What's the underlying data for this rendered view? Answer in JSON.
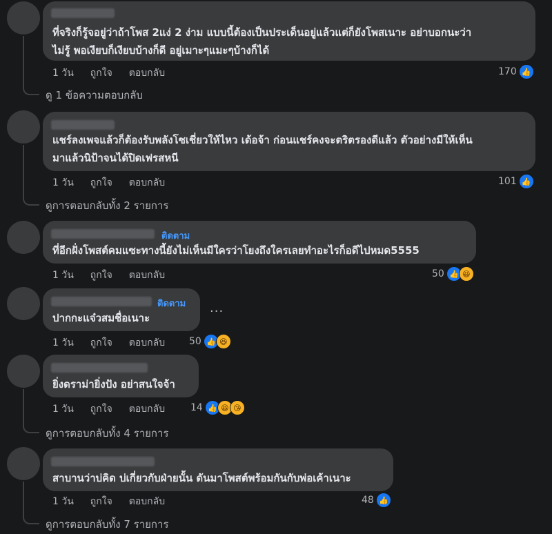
{
  "comments": [
    {
      "follow": "",
      "lines": [
        "ที่จริงก็รู้จอยู่ว่าถ้าโพส 2แง่ 2 ง่าม แบบนี้ต้องเป็นประเด็นอยู่แล้วแต่ก็ยังโพสเนาะ อย่าบอกนะว่า",
        "ไม่รู้ พอเงียบก็เงียบบ้างก็ดี อยู่เมาะๆแมะๆบ้างก็ได้"
      ],
      "time": "1 วัน",
      "like": "ถูกใจ",
      "reply": "ตอบกลับ",
      "count": "170",
      "reactions": [
        "like-icon"
      ],
      "replies": "ดู 1 ข้อความตอบกลับ"
    },
    {
      "follow": "",
      "lines": [
        "แชร์ลงเพจแล้วก็ต้องรับพลังโซเชี่ยวให้ไหว เด้อจ้า ก่อนแชร์คงจะตริตรองดีแล้ว ตัวอย่างมีให้เห็น",
        "มาแล้วนิป้าจนได้ปิดเฟรสหนี"
      ],
      "time": "1 วัน",
      "like": "ถูกใจ",
      "reply": "ตอบกลับ",
      "count": "101",
      "reactions": [
        "like-icon"
      ],
      "replies": "ดูการตอบกลับทั้ง 2 รายการ"
    },
    {
      "follow": "ติดตาม",
      "lines": [
        "ที่อีกฝั่งโพสต์คมแซะทางนี้ยังไม่เห็นมีใครว่าโยงถึงใครเลยทำอะไรก็อดีไปหมด5555"
      ],
      "time": "1 วัน",
      "like": "ถูกใจ",
      "reply": "ตอบกลับ",
      "count": "50",
      "reactions": [
        "like-icon",
        "haha-icon"
      ],
      "replies": ""
    },
    {
      "follow": "ติดตาม",
      "lines": [
        "ปากกะแจ๋วสมชื่อเนาะ"
      ],
      "time": "1 วัน",
      "like": "ถูกใจ",
      "reply": "ตอบกลับ",
      "count": "50",
      "reactions": [
        "like-icon",
        "haha-icon"
      ],
      "replies": "",
      "more": "..."
    },
    {
      "follow": "",
      "lines": [
        "ยิ่งดราม่ายิ่งปัง อย่าสนใจจ้า"
      ],
      "time": "1 วัน",
      "like": "ถูกใจ",
      "reply": "ตอบกลับ",
      "count": "14",
      "reactions": [
        "like-icon",
        "haha-icon",
        "haha-icon"
      ],
      "replies": "ดูการตอบกลับทั้ง 4 รายการ"
    },
    {
      "follow": "",
      "lines": [
        "สาบานว่าบ่คิด บ่เกี่ยวกับฝ่ายนั้น ดันมาโพสต์พร้อมกันกับพ่อเค้าเนาะ"
      ],
      "time": "1 วัน",
      "like": "ถูกใจ",
      "reply": "ตอบกลับ",
      "count": "48",
      "reactions": [
        "like-icon"
      ],
      "replies": "ดูการตอบกลับทั้ง 7 รายการ"
    }
  ]
}
